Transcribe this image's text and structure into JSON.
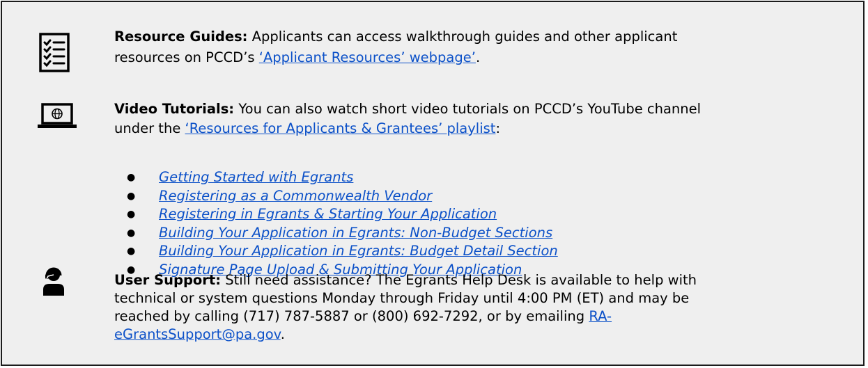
{
  "resource_guides": {
    "label": "Resource Guides:",
    "text": " Applicants can access walkthrough guides and other applicant",
    "text_line2": "resources on PCCD’s ",
    "link": "‘Applicant Resources’ webpage’",
    "end": ".",
    "icon": "checklist-icon"
  },
  "video_tutorials": {
    "label": "Video Tutorials:",
    "text": " You can also watch short video tutorials on PCCD’s YouTube channel",
    "text_line2": "under the ",
    "link": "‘Resources for Applicants & Grantees’ playlist",
    "end": ":",
    "icon": "laptop-globe-icon",
    "videos": [
      "Getting Started with Egrants",
      "Registering as a Commonwealth Vendor",
      "Registering in Egrants & Starting Your Application",
      "Building Your Application in Egrants: Non-Budget Sections",
      "Building Your Application in Egrants: Budget Detail Section",
      "Signature Page Upload & Submitting Your Application"
    ]
  },
  "user_support": {
    "label": "User Support:",
    "line1": " Still need assistance?  The Egrants Help Desk is available to help with",
    "line2": "technical or system questions Monday through Friday until 4:00 PM (ET) and may be",
    "line3": "reached by calling (717) 787-5887 or (800) 692-7292, or by emailing ",
    "email_part1": "RA-",
    "email_part2": "eGrantsSupport@pa.gov",
    "end": ".",
    "icon": "headset-user-icon"
  },
  "colors": {
    "link": "#0b50c8",
    "panel_background": "#efefef",
    "border": "#1c1c1c"
  }
}
